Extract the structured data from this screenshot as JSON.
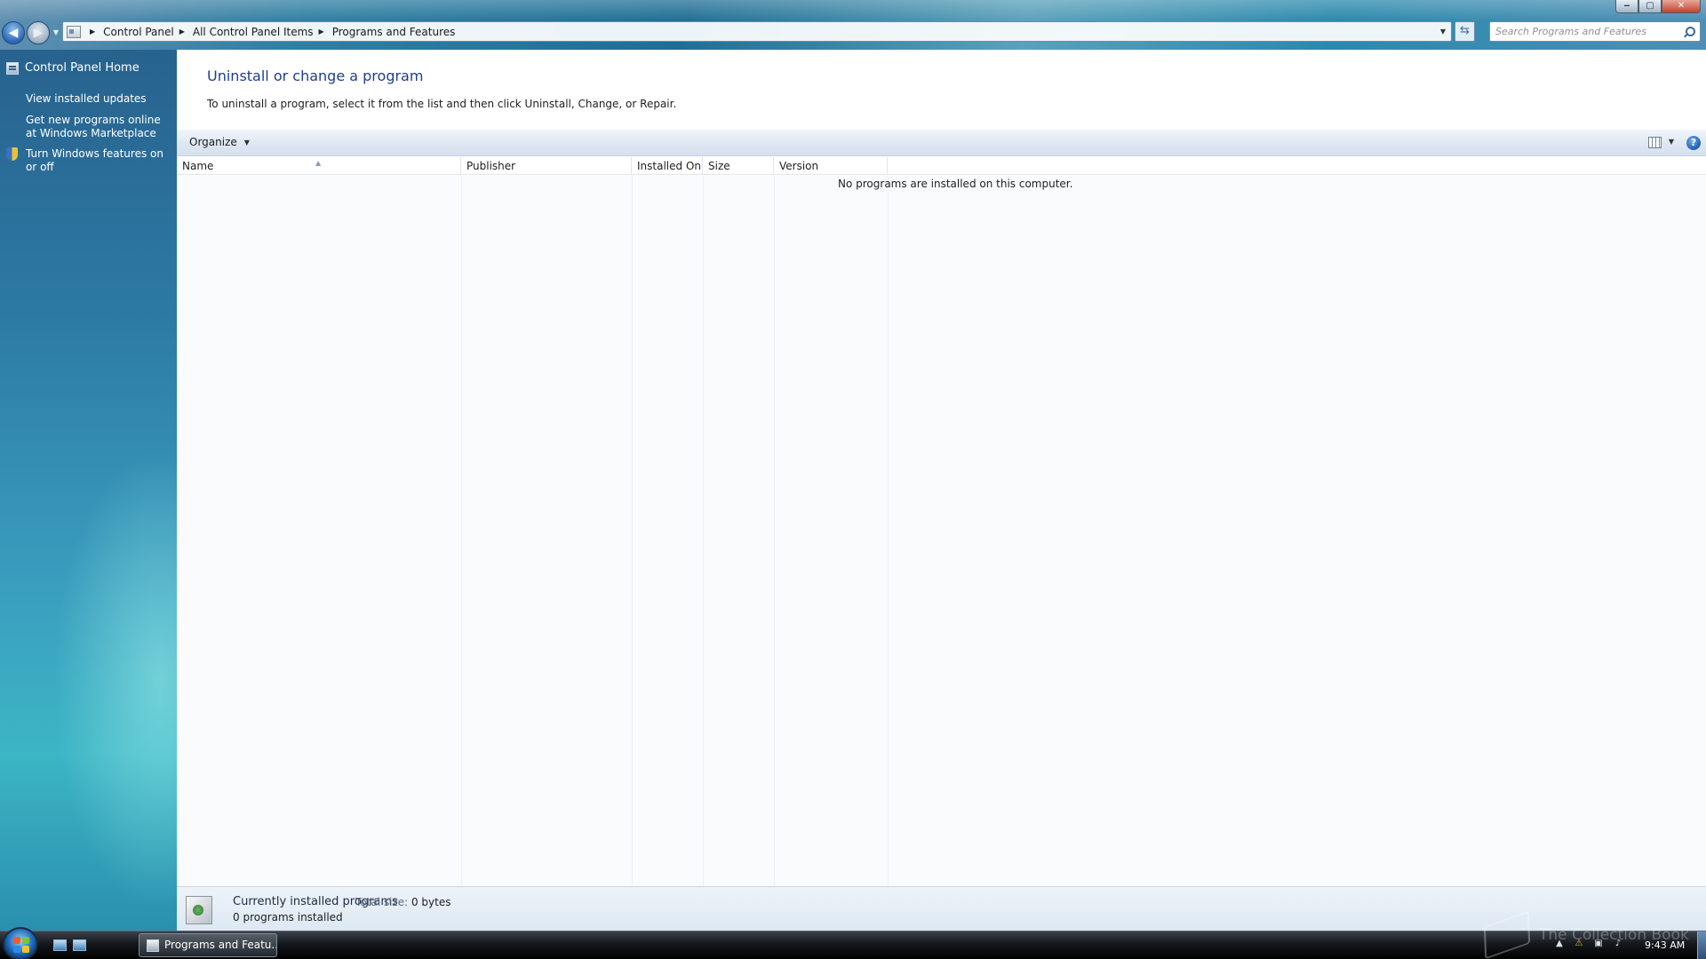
{
  "window": {
    "minimize_glyph": "‒",
    "maximize_glyph": "▢",
    "close_glyph": "✕"
  },
  "address_bar": {
    "breadcrumbs": [
      "Control Panel",
      "All Control Panel Items",
      "Programs and Features"
    ],
    "search_placeholder": "Search Programs and Features"
  },
  "left_pane": {
    "home": "Control Panel Home",
    "links": [
      "View installed updates",
      "Get new programs online at Windows Marketplace",
      "Turn Windows features on or off"
    ]
  },
  "main": {
    "title": "Uninstall or change a program",
    "description": "To uninstall a program, select it from the list and then click Uninstall, Change, or Repair.",
    "toolbar": {
      "organize": "Organize",
      "help_glyph": "?"
    },
    "columns": [
      "Name",
      "Publisher",
      "Installed On",
      "Size",
      "Version"
    ],
    "empty_message": "No programs are installed on this computer."
  },
  "details": {
    "title": "Currently installed programs",
    "total_size_label": "Total size:",
    "total_size_value": "0 bytes",
    "count": "0 programs installed"
  },
  "taskbar": {
    "active_window": "Programs and Featu...",
    "clock": "9:43 AM"
  },
  "watermark": "The Collection Book",
  "colors": {
    "title_blue": "#1e3f8a",
    "left_pane_top": "#28628e",
    "left_pane_bottom": "#3cb5c5",
    "taskbar": "#14181c"
  }
}
